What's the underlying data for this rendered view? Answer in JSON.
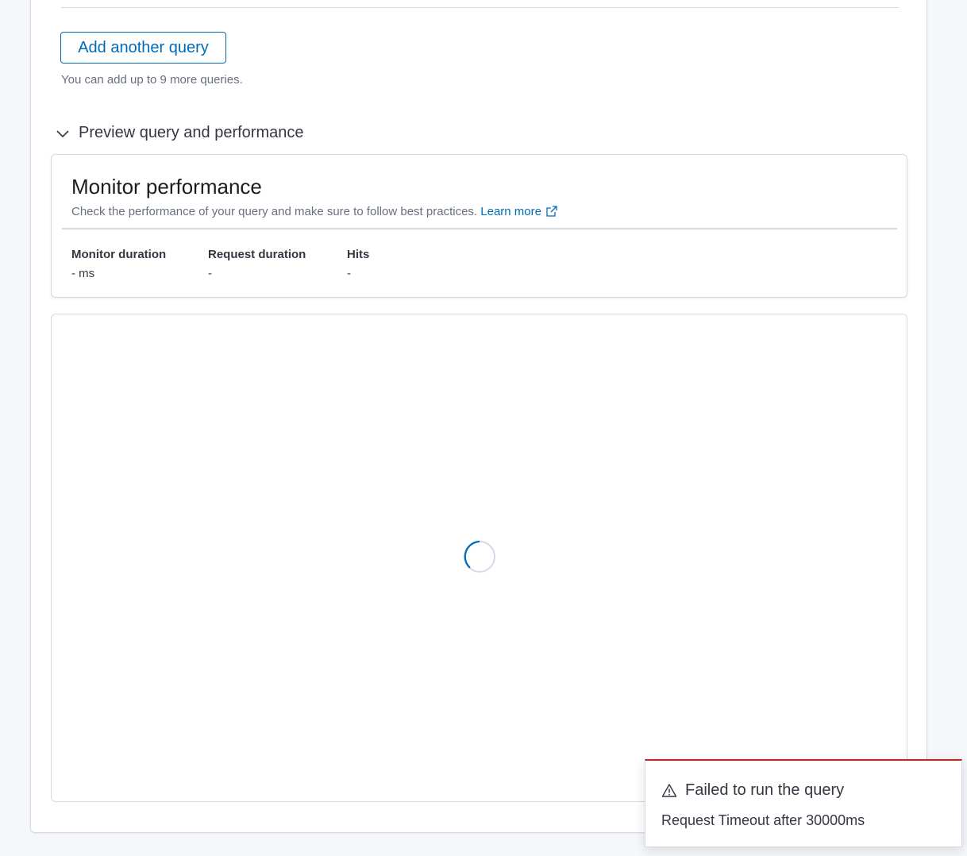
{
  "queries": {
    "add_button_label": "Add another query",
    "hint": "You can add up to 9 more queries."
  },
  "preview": {
    "accordion_label": "Preview query and performance",
    "state": "loading"
  },
  "performance": {
    "title": "Monitor performance",
    "description": "Check the performance of your query and make sure to follow best practices.",
    "learn_more": "Learn more",
    "stats": [
      {
        "title": "Monitor duration",
        "value": "- ms"
      },
      {
        "title": "Request duration",
        "value": "-"
      },
      {
        "title": "Hits",
        "value": "-"
      }
    ]
  },
  "toast": {
    "title": "Failed to run the query",
    "message": "Request Timeout after 30000ms",
    "color": "#bd271e"
  },
  "colors": {
    "accent": "#006bb8",
    "page_bg": "#f5f7fa",
    "border": "#d3dae6"
  },
  "icons": [
    "chevron-down-icon",
    "external-link-icon",
    "loading-spinner-icon",
    "warning-icon"
  ]
}
